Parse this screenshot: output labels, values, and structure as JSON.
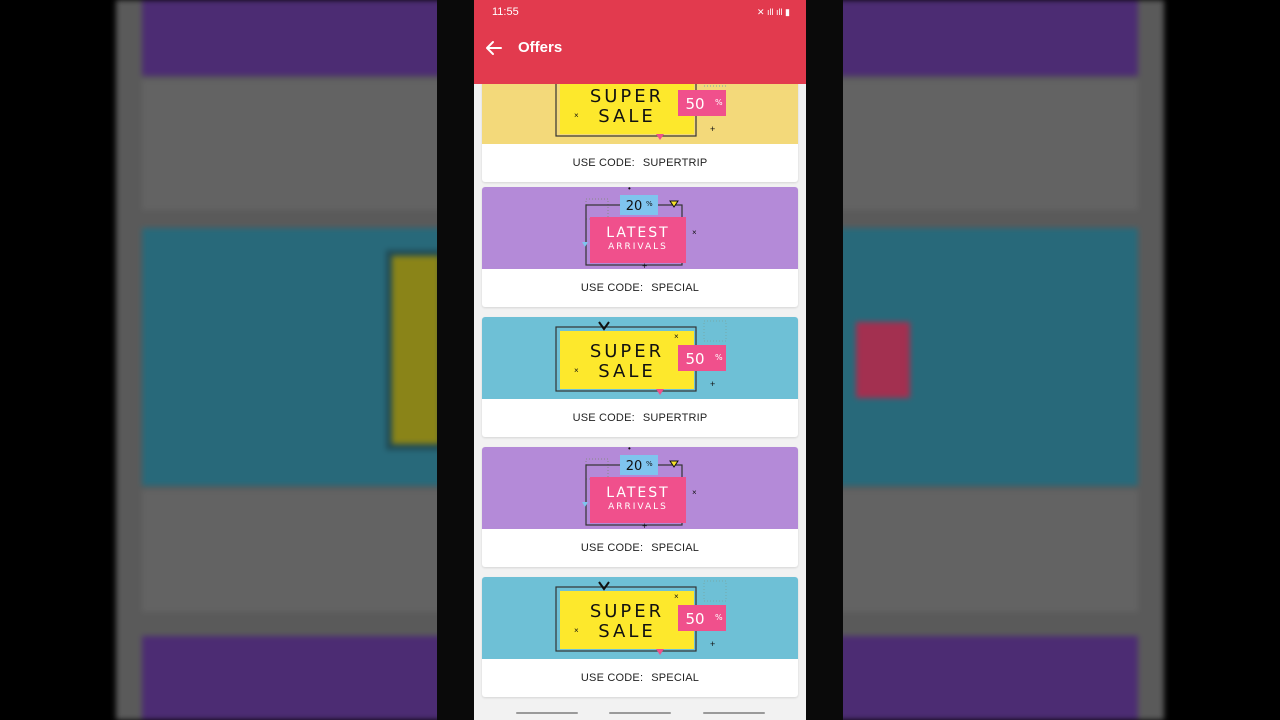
{
  "status_bar": {
    "time": "11:55",
    "icons": "✕ ıll ıll ▮"
  },
  "app_bar": {
    "title": "Offers"
  },
  "colors": {
    "accent": "#e23a4e",
    "yellow_bg": "#f3d97a",
    "purple_bg": "#b48ad8",
    "teal_bg": "#6ec0d6",
    "sale_yellow": "#fde82c",
    "sale_pink": "#f0508c"
  },
  "code_label": "USE CODE:",
  "offers": [
    {
      "type": "super_sale",
      "bg": "yellow",
      "line1": "SUPER",
      "line2": "SALE",
      "percent": "50",
      "code": "SUPERTRIP"
    },
    {
      "type": "latest_arrivals",
      "bg": "purple",
      "line1": "LATEST",
      "line2": "ARRIVALS",
      "percent": "20",
      "code": "SPECIAL"
    },
    {
      "type": "super_sale",
      "bg": "teal",
      "line1": "SUPER",
      "line2": "SALE",
      "percent": "50",
      "code": "SUPERTRIP"
    },
    {
      "type": "latest_arrivals",
      "bg": "purple",
      "line1": "LATEST",
      "line2": "ARRIVALS",
      "percent": "20",
      "code": "SPECIAL"
    },
    {
      "type": "super_sale",
      "bg": "teal",
      "line1": "SUPER",
      "line2": "SALE",
      "percent": "50",
      "code": "SPECIAL"
    }
  ]
}
